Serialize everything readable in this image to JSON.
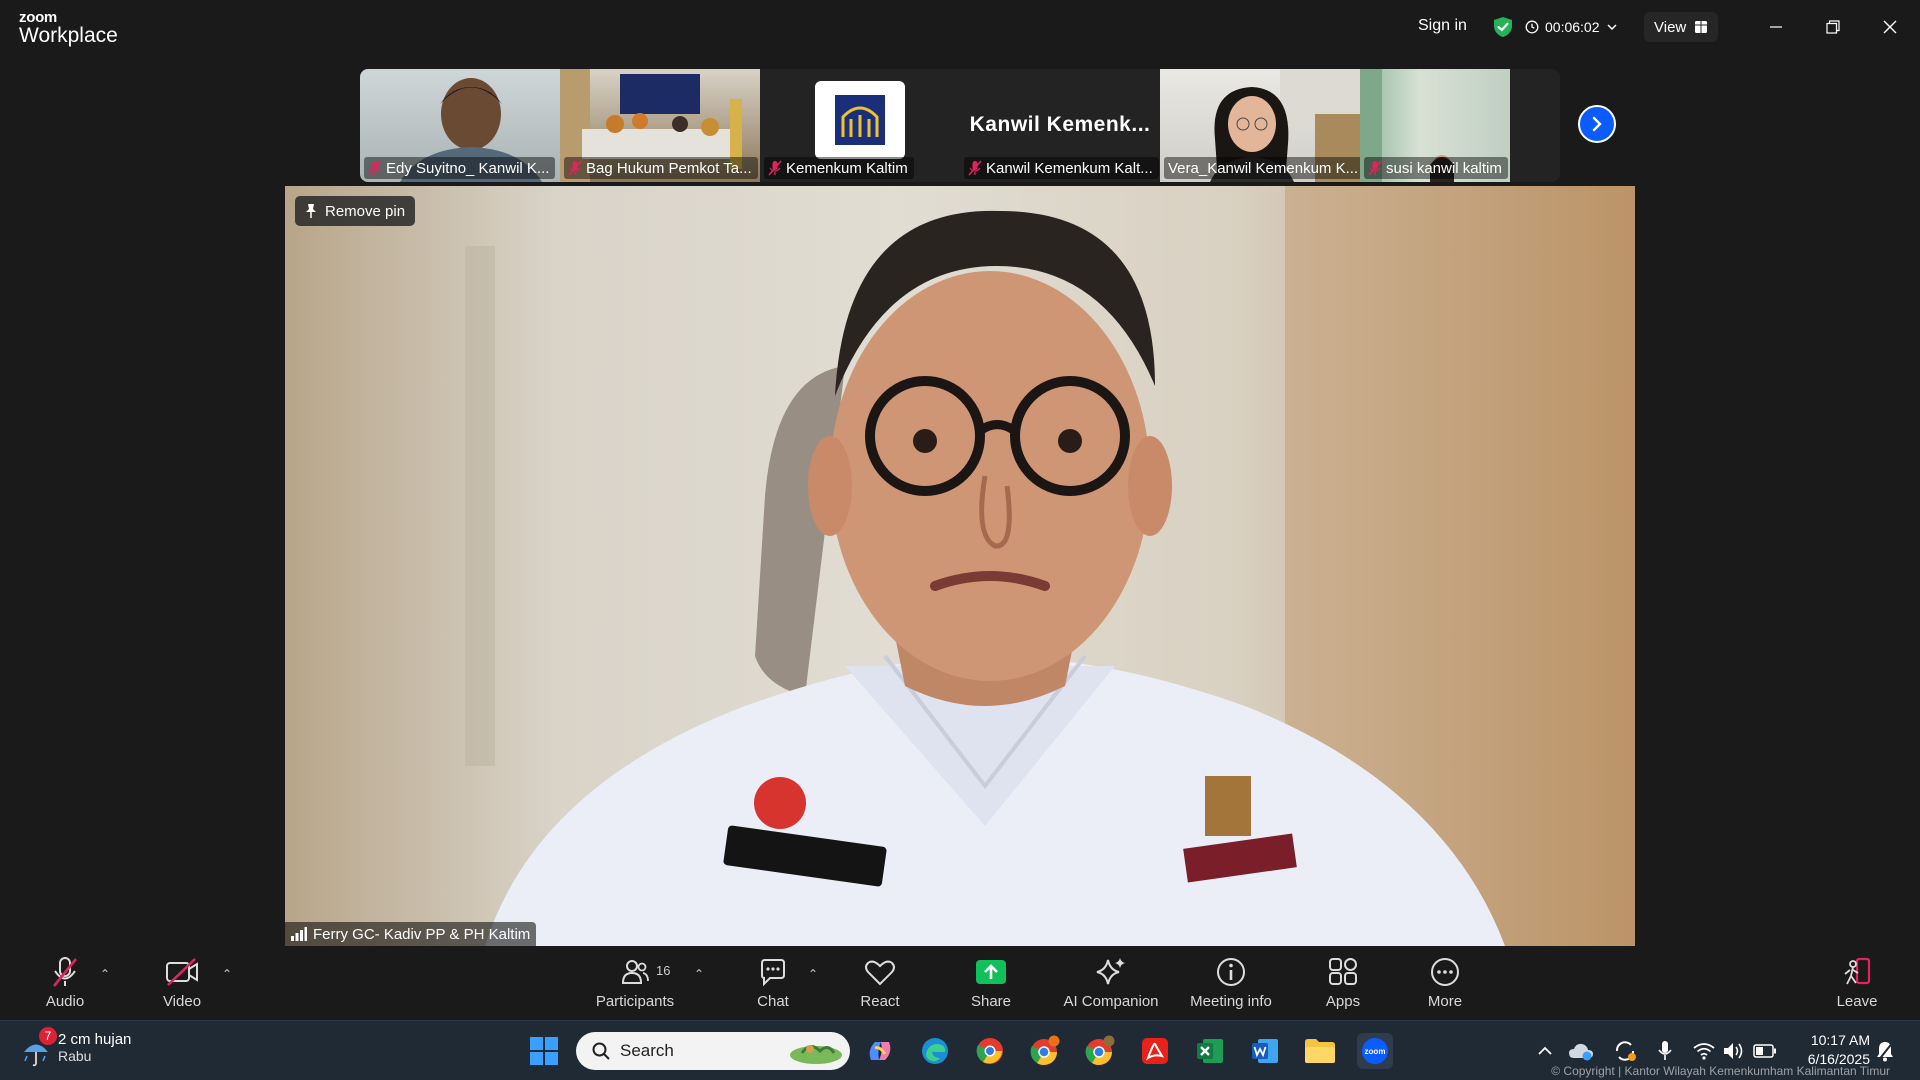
{
  "app": {
    "brand_small": "zoom",
    "brand_large": "Workplace"
  },
  "titlebar": {
    "signin": "Sign in",
    "timer": "00:06:02",
    "view": "View"
  },
  "thumbnails": [
    {
      "name": "Edy Suyitno_ Kanwil K..."
    },
    {
      "name": "Bag Hukum Pemkot Ta..."
    },
    {
      "name": "Kemenkum Kaltim"
    },
    {
      "name": "Kanwil Kemenkum Kalt...",
      "display": "Kanwil  Kemenk..."
    },
    {
      "name": "Vera_Kanwil Kemenkum K..."
    },
    {
      "name": "susi kanwil kaltim"
    }
  ],
  "main_video": {
    "remove_pin": "Remove pin",
    "name": "Ferry GC- Kadiv PP & PH Kaltim"
  },
  "controls": {
    "audio": "Audio",
    "video": "Video",
    "participants": "Participants",
    "participants_count": "16",
    "chat": "Chat",
    "react": "React",
    "share": "Share",
    "ai_companion": "AI Companion",
    "meeting_info": "Meeting info",
    "apps": "Apps",
    "more": "More",
    "leave": "Leave"
  },
  "taskbar": {
    "weather": "2 cm hujan",
    "day": "Rabu",
    "weather_badge": "7",
    "search": "Search",
    "time": "10:17 AM",
    "date": "6/16/2025",
    "copyright": "© Copyright | Kantor Wilayah Kemenkumham Kalimantan Timur"
  },
  "colors": {
    "accent": "#0b5cff",
    "share_green": "#12c05b",
    "leave_red": "#e0245e",
    "mic_off": "#e0245e"
  }
}
